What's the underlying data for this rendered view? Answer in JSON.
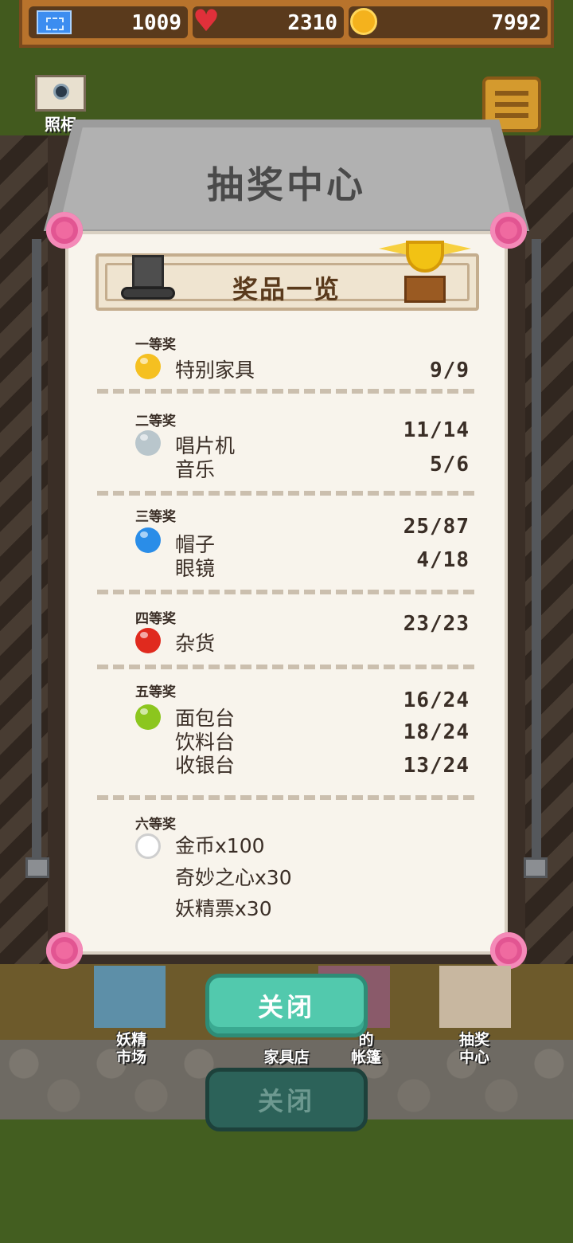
{
  "currency": {
    "tickets": "1009",
    "hearts": "2310",
    "coins": "7992"
  },
  "camera": {
    "label": "照相"
  },
  "shop": {
    "title": "抽奖中心"
  },
  "panel": {
    "title": "奖品一览",
    "tiers": [
      {
        "label": "一等奖",
        "gem_color": "#f5c021",
        "items": [
          {
            "name": "特别家具",
            "count": "9/9"
          }
        ]
      },
      {
        "label": "二等奖",
        "gem_color": "#b9c6cc",
        "items": [
          {
            "name": "唱片机",
            "count": "11/14"
          },
          {
            "name": "音乐",
            "count": "5/6"
          }
        ]
      },
      {
        "label": "三等奖",
        "gem_color": "#2a8de8",
        "items": [
          {
            "name": "帽子",
            "count": "25/87"
          },
          {
            "name": "眼镜",
            "count": "4/18"
          }
        ]
      },
      {
        "label": "四等奖",
        "gem_color": "#e02a1e",
        "items": [
          {
            "name": "杂货",
            "count": "23/23"
          }
        ]
      },
      {
        "label": "五等奖",
        "gem_color": "#8cc61e",
        "items": [
          {
            "name": "面包台",
            "count": "16/24"
          },
          {
            "name": "饮料台",
            "count": "18/24"
          },
          {
            "name": "收银台",
            "count": "13/24"
          }
        ]
      },
      {
        "label": "六等奖",
        "gem_color": "#ffffff",
        "items": [
          {
            "name": "金币x100"
          },
          {
            "name": "奇妙之心x30"
          },
          {
            "name": "妖精票x30"
          }
        ]
      }
    ]
  },
  "stalls": [
    {
      "label": "妖精\n市场"
    },
    {
      "label": "家具店"
    },
    {
      "label": "的\n帐篷"
    },
    {
      "label": "抽奖\n中心"
    }
  ],
  "buttons": {
    "close_primary": "关闭",
    "close_secondary": "关闭"
  }
}
